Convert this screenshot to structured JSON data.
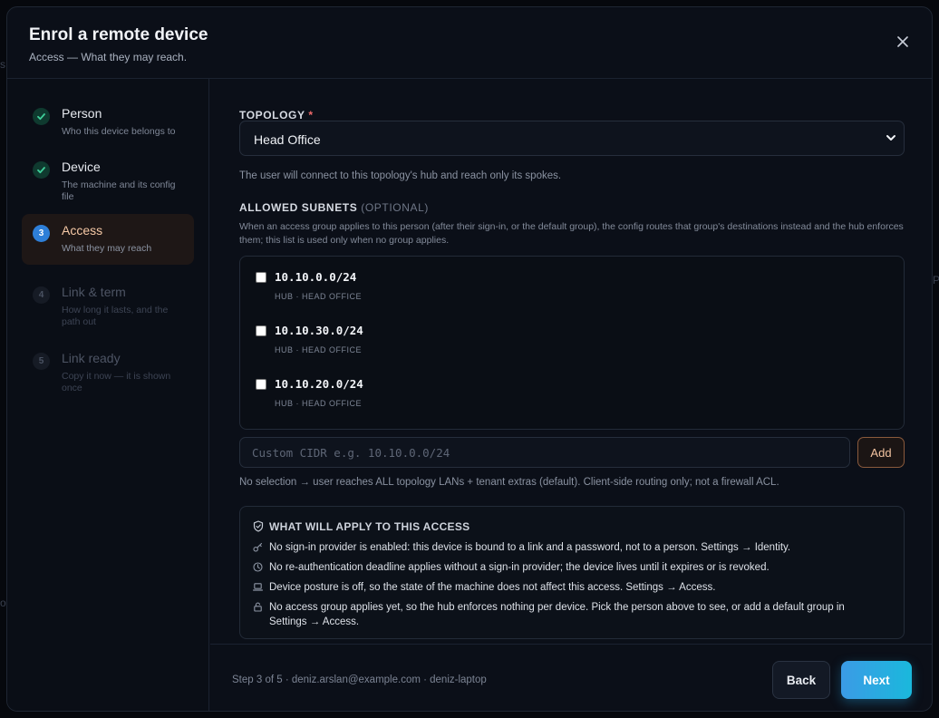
{
  "modal": {
    "title": "Enrol a remote device",
    "subtitle": "Access — What they may reach.",
    "close_icon": "close-icon"
  },
  "steps": [
    {
      "label": "Person",
      "desc": "Who this device belongs to",
      "state": "done",
      "marker": "check"
    },
    {
      "label": "Device",
      "desc": "The machine and its config file",
      "state": "done",
      "marker": "check"
    },
    {
      "label": "Access",
      "desc": "What they may reach",
      "state": "current",
      "marker": "3"
    },
    {
      "label": "Link & term",
      "desc": "How long it lasts, and the path out",
      "state": "pending",
      "marker": "4"
    },
    {
      "label": "Link ready",
      "desc": "Copy it now — it is shown once",
      "state": "pending",
      "marker": "5"
    }
  ],
  "topology": {
    "label": "TOPOLOGY",
    "required_mark": "*",
    "selected": "Head Office",
    "help": "The user will connect to this topology's hub and reach only its spokes."
  },
  "subnets": {
    "label": "ALLOWED SUBNETS",
    "optional": "(OPTIONAL)",
    "desc": "When an access group applies to this person (after their sign-in, or the default group), the config routes that group's destinations instead and the hub enforces them; this list is used only when no group applies.",
    "items": [
      {
        "cidr": "10.10.0.0/24",
        "meta": "HUB · HEAD OFFICE",
        "checked": false
      },
      {
        "cidr": "10.10.30.0/24",
        "meta": "HUB · HEAD OFFICE",
        "checked": false
      },
      {
        "cidr": "10.10.20.0/24",
        "meta": "HUB · HEAD OFFICE",
        "checked": false
      }
    ],
    "custom_placeholder": "Custom CIDR e.g. 10.10.0.0/24",
    "custom_value": "",
    "add_label": "Add",
    "note": "No selection → user reaches ALL topology LANs + tenant extras (default). Client-side routing only; not a firewall ACL."
  },
  "apply": {
    "title": "WHAT WILL APPLY TO THIS ACCESS",
    "icon": "shield-icon",
    "items": [
      {
        "icon": "key-icon",
        "text": "No sign-in provider is enabled: this device is bound to a link and a password, not to a person. Settings → Identity."
      },
      {
        "icon": "clock-icon",
        "text": "No re-authentication deadline applies without a sign-in provider; the device lives until it expires or is revoked."
      },
      {
        "icon": "laptop-icon",
        "text": "Device posture is off, so the state of the machine does not affect this access. Settings → Access."
      },
      {
        "icon": "lock-icon",
        "text": "No access group applies yet, so the hub enforces nothing per device. Pick the person above to see, or add a default group in Settings → Access."
      }
    ]
  },
  "footer": {
    "status": "Step 3 of 5 · deniz.arslan@example.com · deniz-laptop",
    "back_label": "Back",
    "next_label": "Next"
  },
  "colors": {
    "accent": "#2e7fd8",
    "accent_warm": "#f6c9a6",
    "success": "#3fcf9a",
    "danger": "#f06a6a",
    "next_gradient_start": "#3b9be6",
    "next_gradient_end": "#1ab8dc"
  }
}
